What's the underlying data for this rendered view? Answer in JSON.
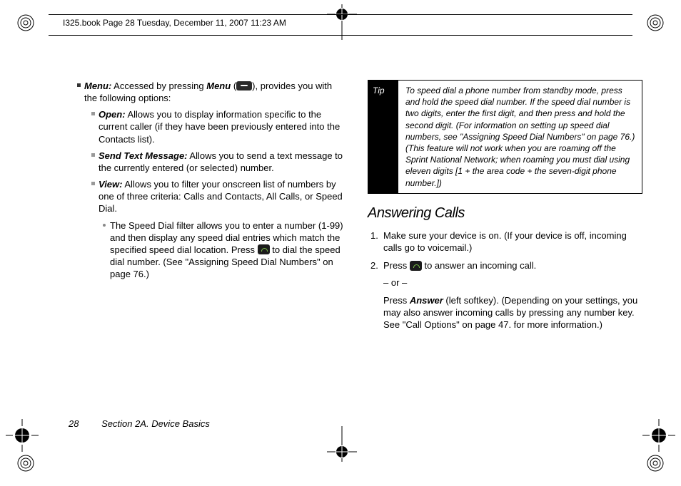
{
  "header": {
    "running_head": "I325.book  Page 28  Tuesday, December 11, 2007  11:23 AM"
  },
  "left": {
    "menu": {
      "label": "Menu:",
      "desc_prefix": " Accessed by pressing ",
      "menu_word": "Menu",
      "desc_mid": " (",
      "desc_suffix": "), provides you with the following options:"
    },
    "open": {
      "label": "Open:",
      "desc": " Allows you to display information specific to the current caller (if they have been previously entered into the Contacts list)."
    },
    "send": {
      "label": "Send Text Message:",
      "desc": " Allows you to send a text message to the currently entered (or selected) number."
    },
    "view": {
      "label": "View:",
      "desc": " Allows you to filter your onscreen list of numbers by one of three criteria: Calls and Contacts, All Calls, or Speed Dial."
    },
    "speed": {
      "p1": "The Speed Dial filter allows you to enter a number (1-99) and then display any speed dial entries which match the specified speed dial location. Press ",
      "p2": " to dial the speed dial number. (See \"Assigning Speed Dial Numbers\" on page 76.)"
    }
  },
  "right": {
    "tip": {
      "label": "Tip",
      "body": "To speed dial a phone number from standby mode, press and hold the speed dial number. If the speed dial number is two digits, enter the first digit, and then press and hold the second digit. (For information on setting up speed dial numbers, see \"Assigning Speed Dial Numbers\" on page 76.) (This feature will not work when you are roaming off the Sprint National Network; when roaming you must dial using eleven digits [1 + the area code + the seven-digit phone number.])"
    },
    "heading": "Answering Calls",
    "step1": {
      "num": "1.",
      "text": "Make sure your device is on. (If your device is off, incoming calls go to voicemail.)"
    },
    "step2": {
      "num": "2.",
      "p1": "Press ",
      "p2": " to answer an incoming call.",
      "or": "– or –",
      "p3a": "Press ",
      "answer": "Answer",
      "p3b": " (left softkey). (Depending on your settings, you may also answer incoming calls by pressing any number key. See \"Call Options\" on page 47. for more information.)"
    }
  },
  "footer": {
    "page": "28",
    "section": "Section 2A. Device Basics"
  }
}
